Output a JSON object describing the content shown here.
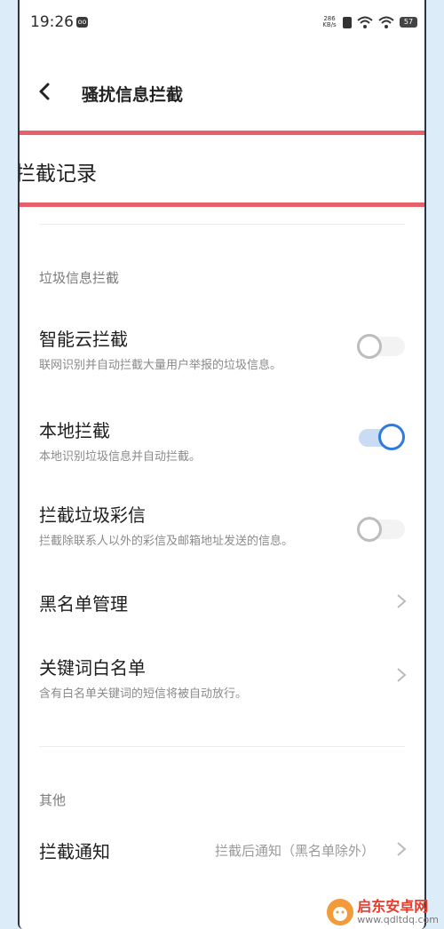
{
  "status_bar": {
    "time": "19:26",
    "app_icon": "oo",
    "net_speed_value": "286",
    "net_speed_unit": "KB/s",
    "battery": "57"
  },
  "nav": {
    "title": "骚扰信息拦截"
  },
  "record": {
    "label": "拦截记录"
  },
  "spam_section": {
    "header": "垃圾信息拦截",
    "smart_cloud": {
      "title": "智能云拦截",
      "subtitle": "联网识别并自动拦截大量用户举报的垃圾信息。",
      "enabled": false
    },
    "local": {
      "title": "本地拦截",
      "subtitle": "本地识别垃圾信息并自动拦截。",
      "enabled": true
    },
    "mms": {
      "title": "拦截垃圾彩信",
      "subtitle": "拦截除联系人以外的彩信及邮箱地址发送的信息。",
      "enabled": false
    },
    "blacklist": {
      "title": "黑名单管理"
    },
    "keyword_whitelist": {
      "title": "关键词白名单",
      "subtitle": "含有白名单关键词的短信将被自动放行。"
    }
  },
  "other_section": {
    "header": "其他",
    "notification": {
      "title": "拦截通知",
      "value": "拦截后通知（黑名单除外）"
    }
  },
  "watermark": {
    "title": "启东安卓网",
    "url": "www.qdltdq.com"
  },
  "colors": {
    "accent": "#2f7ae0",
    "highlight_border": "#e8606a",
    "background": "#dcecf8"
  }
}
